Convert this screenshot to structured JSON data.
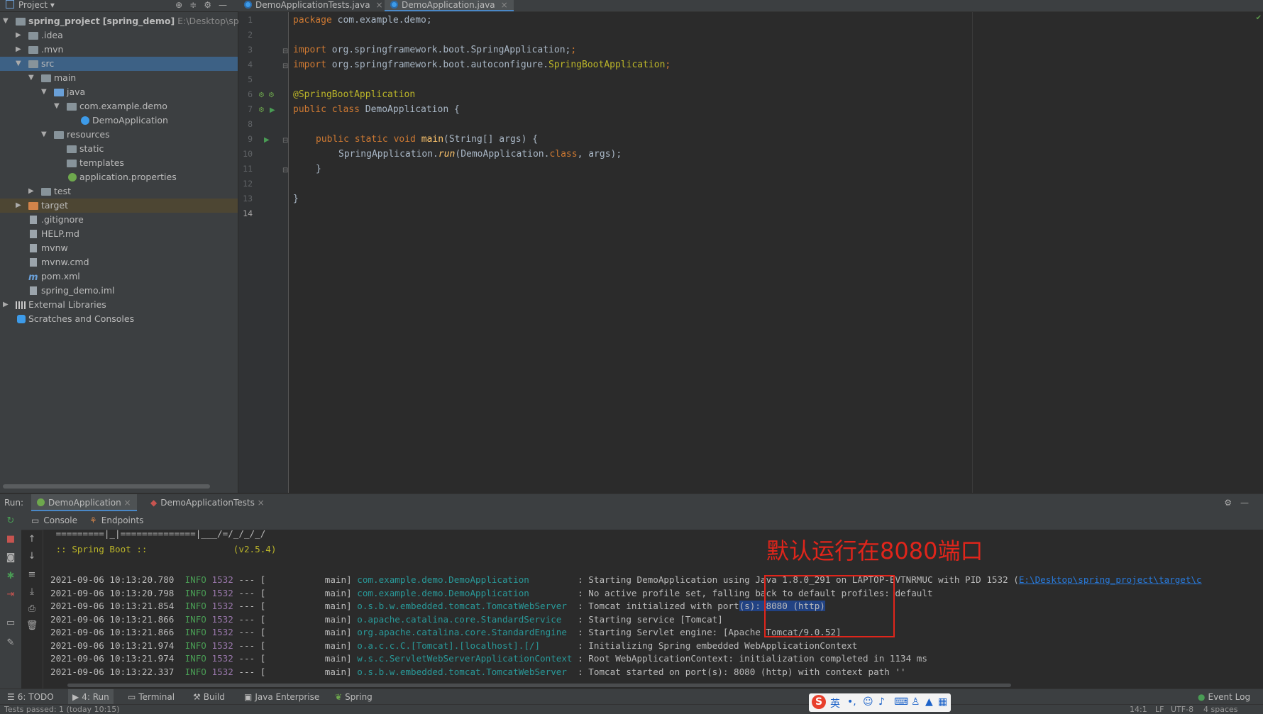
{
  "project_header": {
    "title": "Project",
    "dropdown": "▾",
    "tools": [
      "⊕",
      "≑",
      "⚙",
      "—"
    ]
  },
  "tabs": [
    {
      "label": "DemoApplicationTests.java",
      "close": "×"
    },
    {
      "label": "DemoApplication.java",
      "close": "×"
    }
  ],
  "tree": {
    "root_name": "spring_project",
    "root_module": "[spring_demo]",
    "root_path": "E:\\Desktop\\spring_",
    "items": [
      {
        "label": ".idea"
      },
      {
        "label": ".mvn"
      },
      {
        "label": "src"
      },
      {
        "label": "main"
      },
      {
        "label": "java"
      },
      {
        "label": "com.example.demo"
      },
      {
        "label": "DemoApplication"
      },
      {
        "label": "resources"
      },
      {
        "label": "static"
      },
      {
        "label": "templates"
      },
      {
        "label": "application.properties"
      },
      {
        "label": "test"
      },
      {
        "label": "target"
      },
      {
        "label": ".gitignore"
      },
      {
        "label": "HELP.md"
      },
      {
        "label": "mvnw"
      },
      {
        "label": "mvnw.cmd"
      },
      {
        "label": "pom.xml"
      },
      {
        "label": "spring_demo.iml"
      },
      {
        "label": "External Libraries"
      },
      {
        "label": "Scratches and Consoles"
      }
    ]
  },
  "editor": {
    "line_numbers": [
      "1",
      "2",
      "3",
      "4",
      "5",
      "6",
      "7",
      "8",
      "9",
      "10",
      "11",
      "12",
      "13",
      "14"
    ],
    "code": {
      "l1_kw": "package",
      "l1_rest": " com.example.demo;",
      "l3_kw": "import",
      "l3_rest": " org.springframework.boot.SpringApplication;",
      "l4_kw": "import",
      "l4_rest": " org.springframework.boot.autoconfigure.",
      "l4_cls": "SpringBootApplication",
      "l4_end": ";",
      "l6": "@SpringBootApplication",
      "l7_kw": "public class",
      "l7_rest": " DemoApplication {",
      "l9_kw": "public static void",
      "l9_fn": " main",
      "l9_rest": "(String[] args) {",
      "l10_a": "SpringApplication.",
      "l10_fn": "run",
      "l10_b": "(DemoApplication.",
      "l10_kw": "class",
      "l10_c": ", args);",
      "l11": "}",
      "l13": "}"
    }
  },
  "run_panel": {
    "label": "Run:",
    "tabs": [
      {
        "label": "DemoApplication",
        "close": "×"
      },
      {
        "label": "DemoApplicationTests",
        "close": "×"
      }
    ],
    "right_tools": [
      "⚙",
      "—"
    ],
    "console_tabs": [
      "Console",
      "Endpoints"
    ],
    "banner1": " =========|_|==============|___/=/_/_/_/",
    "banner2": " :: Spring Boot ::                (v2.5.4)",
    "logs": [
      {
        "ts": "2021-09-06 10:13:20.780",
        "level": "INFO",
        "pid": "1532",
        "sep": " --- [           main] ",
        "logger": "com.example.demo.DemoApplication        ",
        "msg": " : Starting DemoApplication using Java 1.8.0_291 on LAPTOP-EVTNRMUC with PID 1532 (",
        "link": "E:\\Desktop\\spring_project\\target\\c"
      },
      {
        "ts": "2021-09-06 10:13:20.798",
        "level": "INFO",
        "pid": "1532",
        "sep": " --- [           main] ",
        "logger": "com.example.demo.DemoApplication        ",
        "msg": " : No active profile set, falling back to default profiles: default"
      },
      {
        "ts": "2021-09-06 10:13:21.854",
        "level": "INFO",
        "pid": "1532",
        "sep": " --- [           main] ",
        "logger": "o.s.b.w.embedded.tomcat.TomcatWebServer ",
        "msg": " : Tomcat initialized with port",
        "hl": "(s): 8080 (http)"
      },
      {
        "ts": "2021-09-06 10:13:21.866",
        "level": "INFO",
        "pid": "1532",
        "sep": " --- [           main] ",
        "logger": "o.apache.catalina.core.StandardService  ",
        "msg": " : Starting service [Tomcat]"
      },
      {
        "ts": "2021-09-06 10:13:21.866",
        "level": "INFO",
        "pid": "1532",
        "sep": " --- [           main] ",
        "logger": "org.apache.catalina.core.StandardEngine ",
        "msg": " : Starting Servlet engine: [Apache Tomcat/9.0.52]"
      },
      {
        "ts": "2021-09-06 10:13:21.974",
        "level": "INFO",
        "pid": "1532",
        "sep": " --- [           main] ",
        "logger": "o.a.c.c.C.[Tomcat].[localhost].[/]      ",
        "msg": " : Initializing Spring embedded WebApplicationContext"
      },
      {
        "ts": "2021-09-06 10:13:21.974",
        "level": "INFO",
        "pid": "1532",
        "sep": " --- [           main] ",
        "logger": "w.s.c.ServletWebServerApplicationContext",
        "msg": " : Root WebApplicationContext: initialization completed in 1134 ms"
      },
      {
        "ts": "2021-09-06 10:13:22.337",
        "level": "INFO",
        "pid": "1532",
        "sep": " --- [           main] ",
        "logger": "o.s.b.w.embedded.tomcat.TomcatWebServer ",
        "msg": " : Tomcat started on port(s): 8080 (http) with context path ''"
      }
    ],
    "annotation": "默认运行在8080端口"
  },
  "bottom_tabs": [
    {
      "label": "6: TODO"
    },
    {
      "label": "4: Run"
    },
    {
      "label": "Terminal"
    },
    {
      "label": "Build"
    },
    {
      "label": "Java Enterprise"
    },
    {
      "label": "Spring"
    },
    {
      "label": "Event Log"
    }
  ],
  "status": {
    "left": "Tests passed: 1 (today 10:15)",
    "pos": "14:1",
    "eol": "LF",
    "encoding": "UTF-8",
    "indent": "4 spaces"
  },
  "ime": {
    "logo": "S",
    "lang": "英"
  },
  "colors": {
    "accent": "#4a88c7",
    "selection": "#3d6185",
    "annotation": "#e0251b",
    "info": "#499c54",
    "logger": "#299999"
  }
}
